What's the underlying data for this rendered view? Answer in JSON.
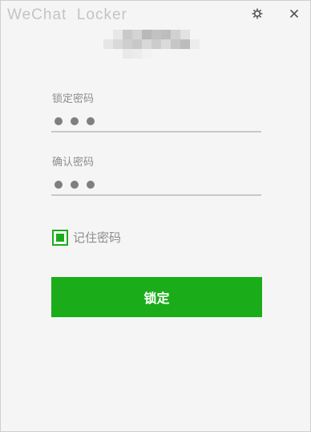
{
  "window": {
    "title": "WeChat  Locker",
    "settings_icon": "gear-icon",
    "close_icon": "close-icon"
  },
  "user": {
    "avatar_mosaic": "username-mosaic",
    "mosaic_colors": [
      [
        "#f5f5f5",
        "#e7e7e7",
        "#c9c9c9",
        "#d4d4d4",
        "#b9b9b9",
        "#c2c2c2",
        "#bdbdbd",
        "#d1d1d1",
        "#e2e2e2",
        "#f5f5f5"
      ],
      [
        "#e6e6e6",
        "#d9d9d9",
        "#cfcfcf",
        "#c8c8c8",
        "#d8d8d8",
        "#cccccc",
        "#dadada",
        "#c6c6c6",
        "#bcbcbc",
        "#ececec"
      ],
      [
        "#f5f5f5",
        "#f5f5f5",
        "#e9e9e9",
        "#ececec",
        "#f2f2f2",
        "#f5f5f5",
        "#f5f5f5",
        "#f5f5f5",
        "#f5f5f5",
        "#f5f5f5"
      ]
    ]
  },
  "form": {
    "lock_password_label": "锁定密码",
    "lock_password_value": "•••",
    "confirm_password_label": "确认密码",
    "confirm_password_value": "•••",
    "remember_label": "记住密码",
    "remember_checked": true,
    "submit_label": "锁定"
  },
  "colors": {
    "accent": "#1aad19",
    "text_muted": "#8d8d8d",
    "background": "#f5f5f5"
  }
}
